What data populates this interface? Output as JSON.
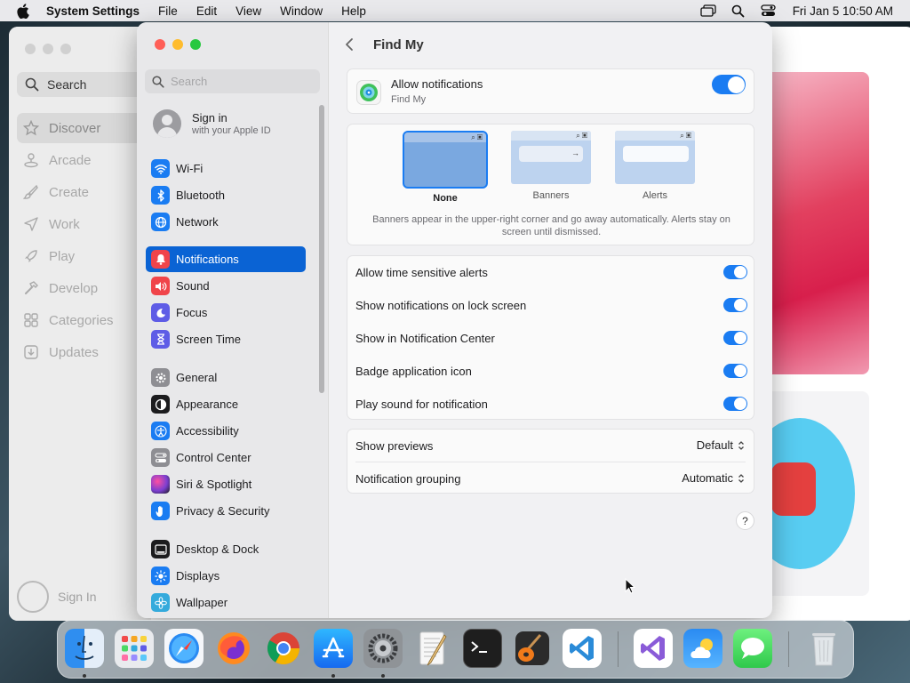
{
  "menubar": {
    "app_name": "System Settings",
    "menus": [
      "File",
      "Edit",
      "View",
      "Window",
      "Help"
    ],
    "clock": "Fri Jan 5  10:50 AM"
  },
  "appstore": {
    "search_label": "Search",
    "items": [
      {
        "label": "Discover",
        "icon": "star-icon",
        "active": true
      },
      {
        "label": "Arcade",
        "icon": "joystick-icon"
      },
      {
        "label": "Create",
        "icon": "paintbrush-icon"
      },
      {
        "label": "Work",
        "icon": "paperplane-icon"
      },
      {
        "label": "Play",
        "icon": "rocket-icon"
      },
      {
        "label": "Develop",
        "icon": "hammer-icon"
      },
      {
        "label": "Categories",
        "icon": "grid-icon"
      },
      {
        "label": "Updates",
        "icon": "download-icon"
      }
    ],
    "sign_in": "Sign In"
  },
  "settings": {
    "search_placeholder": "Search",
    "profile": {
      "name": "Sign in",
      "subtitle": "with your Apple ID"
    },
    "nav": [
      {
        "label": "Wi-Fi",
        "icon": "wifi-icon",
        "color": "#1a7cf2"
      },
      {
        "label": "Bluetooth",
        "icon": "bluetooth-icon",
        "color": "#1a7cf2"
      },
      {
        "label": "Network",
        "icon": "globe-icon",
        "color": "#1a7cf2"
      },
      {
        "label": "Notifications",
        "icon": "bell-icon",
        "color": "#f0444a",
        "active": true
      },
      {
        "label": "Sound",
        "icon": "speaker-icon",
        "color": "#f0444a"
      },
      {
        "label": "Focus",
        "icon": "moon-icon",
        "color": "#5e5ce6"
      },
      {
        "label": "Screen Time",
        "icon": "hourglass-icon",
        "color": "#5e5ce6"
      },
      {
        "label": "General",
        "icon": "gear-icon",
        "color": "#8e8e93"
      },
      {
        "label": "Appearance",
        "icon": "appearance-icon",
        "color": "#1c1c1e"
      },
      {
        "label": "Accessibility",
        "icon": "accessibility-icon",
        "color": "#1a7cf2"
      },
      {
        "label": "Control Center",
        "icon": "toggles-icon",
        "color": "#8e8e93"
      },
      {
        "label": "Siri & Spotlight",
        "icon": "siri-icon",
        "color": "#7b3fd0"
      },
      {
        "label": "Privacy & Security",
        "icon": "hand-icon",
        "color": "#1a7cf2"
      },
      {
        "label": "Desktop & Dock",
        "icon": "dock-icon",
        "color": "#1c1c1e"
      },
      {
        "label": "Displays",
        "icon": "sun-icon",
        "color": "#1a7cf2"
      },
      {
        "label": "Wallpaper",
        "icon": "flower-icon",
        "color": "#34aadc"
      }
    ],
    "header": {
      "title": "Find My"
    },
    "allow": {
      "title": "Allow notifications",
      "subtitle": "Find My",
      "enabled": true
    },
    "styles": [
      {
        "label": "None",
        "selected": true
      },
      {
        "label": "Banners"
      },
      {
        "label": "Alerts"
      }
    ],
    "style_description": "Banners appear in the upper-right corner and go away automatically. Alerts stay on screen until dismissed.",
    "toggles": [
      {
        "label": "Allow time sensitive alerts",
        "enabled": true
      },
      {
        "label": "Show notifications on lock screen",
        "enabled": true
      },
      {
        "label": "Show in Notification Center",
        "enabled": true
      },
      {
        "label": "Badge application icon",
        "enabled": true
      },
      {
        "label": "Play sound for notification",
        "enabled": true
      }
    ],
    "selects": [
      {
        "label": "Show previews",
        "value": "Default"
      },
      {
        "label": "Notification grouping",
        "value": "Automatic"
      }
    ],
    "help": "?"
  },
  "dock": {
    "apps": [
      "Finder",
      "Launchpad",
      "Safari",
      "Firefox",
      "Chrome",
      "App Store",
      "System Settings",
      "TextEdit",
      "Terminal",
      "GarageBand",
      "VS Code",
      "Visual Studio",
      "Weather",
      "Messages",
      "Trash"
    ]
  }
}
